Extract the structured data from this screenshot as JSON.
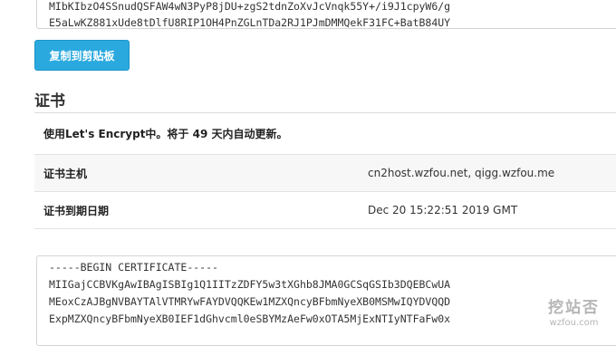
{
  "private_key": {
    "lines": [
      "MIbKIbzO4SSnudQSFAW4wN3PyP8jDU+zgS2tdnZoXvJcVnqk55Y+/i9J1cpyW6/g",
      "E5aLwKZ881xUde8tDlfU8RIP1OH4PnZGLnTDa2RJ1PJmDMMQekF31FC+BatB84UY"
    ]
  },
  "copy_button": {
    "label": "复制到剪贴板"
  },
  "certificate": {
    "title": "证书",
    "note": "使用Let's Encrypt中。将于 49 天内自动更新。",
    "rows": [
      {
        "label": "证书主机",
        "value": "cn2host.wzfou.net, qigg.wzfou.me"
      },
      {
        "label": "证书到期日期",
        "value": "Dec 20 15:22:51 2019 GMT"
      }
    ],
    "pem_lines": [
      "-----BEGIN CERTIFICATE-----",
      "MIIGajCCBVKgAwIBAgISBIg1Q1IITzZDFY5w3tXGhb8JMA0GCSqGSIb3DQEBCwUA",
      "MEoxCzAJBgNVBAYTAlVTMRYwFAYDVQQKEw1MZXQncyBFbmNyeXB0MSMwIQYDVQQD",
      "ExpMZXQncyBFbmNyeXB0IEF1dGhvcml0eSBYMzAeFw0xOTA5MjExNTIyNTFaFw0x"
    ]
  },
  "watermark": {
    "main": "挖站否",
    "sub": "wzfou.com"
  }
}
